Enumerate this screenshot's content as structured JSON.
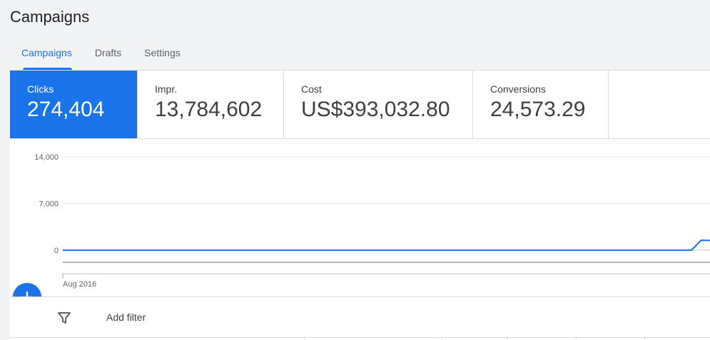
{
  "page": {
    "title": "Campaigns"
  },
  "tabs": [
    {
      "label": "Campaigns",
      "active": true
    },
    {
      "label": "Drafts",
      "active": false
    },
    {
      "label": "Settings",
      "active": false
    }
  ],
  "metrics": [
    {
      "label": "Clicks",
      "value": "274,404",
      "active": true
    },
    {
      "label": "Impr.",
      "value": "13,784,602",
      "active": false
    },
    {
      "label": "Cost",
      "value": "US$393,032.80",
      "active": false
    },
    {
      "label": "Conversions",
      "value": "24,573.29",
      "active": false
    }
  ],
  "chart_data": {
    "type": "line",
    "title": "",
    "xlabel": "",
    "ylabel": "",
    "ylim": [
      0,
      14000
    ],
    "yticks": [
      "14,000",
      "7,000",
      "0"
    ],
    "x_tick_labels": [
      "Aug 2016"
    ],
    "series": [
      {
        "values": [
          0,
          0,
          0,
          0,
          0,
          0,
          0,
          0,
          0,
          0,
          0,
          0,
          0,
          0,
          0,
          0,
          0,
          0,
          0,
          0,
          1500,
          1450,
          0
        ]
      }
    ],
    "grid": true,
    "color": "#1a73e8"
  },
  "fab": {
    "icon": "plus-icon"
  },
  "filter": {
    "label": "Add filter",
    "icon": "filter-icon"
  },
  "colors": {
    "accent": "#1a73e8",
    "border": "#dadce0",
    "background": "#f1f3f4"
  }
}
